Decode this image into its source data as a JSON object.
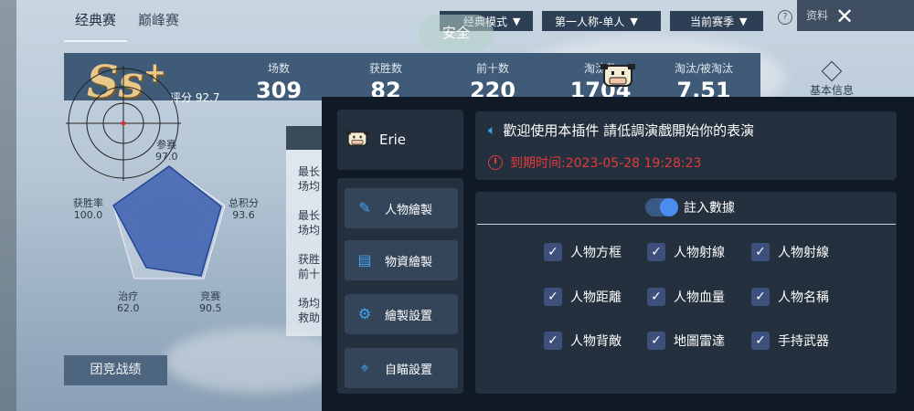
{
  "game": {
    "tabs": [
      "经典赛",
      "巅峰赛"
    ],
    "dropdowns": [
      "经典模式",
      "第一人称-单人",
      "当前赛季"
    ],
    "close_label": "资料",
    "safe_text": "安全",
    "rank": "Ss",
    "rank_sup": "+",
    "score": "评分 92.7",
    "stats": [
      {
        "label": "场数",
        "value": "309"
      },
      {
        "label": "获胜数",
        "value": "82"
      },
      {
        "label": "前十数",
        "value": "220"
      },
      {
        "label": "淘汰数",
        "value": "1704"
      },
      {
        "label": "淘汰/被淘汰",
        "value": "7.51"
      }
    ],
    "basic_info": "基本信息",
    "radar": {
      "participate": {
        "label": "参赛",
        "value": "97.0"
      },
      "total_score": {
        "label": "总积分",
        "value": "93.6"
      },
      "compete": {
        "label": "竞赛",
        "value": "90.5"
      },
      "heal": {
        "label": "治疗",
        "value": "62.0"
      },
      "win_rate": {
        "label": "获胜率",
        "value": "100.0"
      }
    },
    "side_items": [
      [
        "最长",
        "场均"
      ],
      [
        "最长",
        "场均"
      ],
      [
        "获胜",
        "前十"
      ],
      [
        "场均",
        "救助"
      ]
    ],
    "team_button": "团竞战绩"
  },
  "cheat": {
    "username": "Erie",
    "menu": [
      {
        "label": "人物繪製",
        "icon": "pencil-icon"
      },
      {
        "label": "物資繪製",
        "icon": "box-icon"
      },
      {
        "label": "繪製設置",
        "icon": "gear-icon"
      },
      {
        "label": "自瞄設置",
        "icon": "crosshair-icon"
      }
    ],
    "welcome": "歡迎使用本插件 請低調演戲開始你的表演",
    "expire": "到期时间:2023-05-28 19:28:23",
    "toggle_label": "註入數據",
    "options": [
      [
        "人物方框",
        "人物射線",
        "人物射線"
      ],
      [
        "人物距離",
        "人物血量",
        "人物名稱"
      ],
      [
        "人物背敵",
        "地圖雷達",
        "手持武器"
      ]
    ],
    "accent": "#3fa6f0",
    "alert_color": "#e33b3b"
  }
}
